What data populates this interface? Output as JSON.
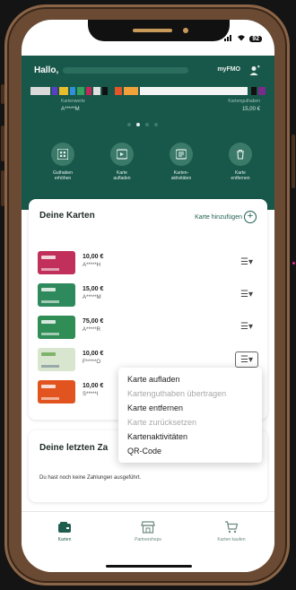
{
  "status": {
    "wifi": "▲",
    "battery": "92"
  },
  "header": {
    "greeting": "Hallo,",
    "brand": "myFMO"
  },
  "balance": {
    "left_label": "Kartenwerte",
    "left_value": "A*****M",
    "right_label": "Kartenguthaben",
    "right_value": "15,00 €"
  },
  "quick_actions": [
    {
      "label": "Guthaben\nerhöhen",
      "icon": "grid-icon"
    },
    {
      "label": "Karte\naufladen",
      "icon": "card-load-icon"
    },
    {
      "label": "Karten-\naktivitäten",
      "icon": "activity-icon"
    },
    {
      "label": "Karte\nentfernen",
      "icon": "trash-icon"
    }
  ],
  "cards_panel": {
    "title": "Deine Karten",
    "add_label": "Karte hinzufügen",
    "cards": [
      {
        "amount": "10,00 €",
        "id": "A*****H",
        "color": "#c0305a"
      },
      {
        "amount": "15,00 €",
        "id": "A*****M",
        "color": "#2e8a5c"
      },
      {
        "amount": "75,00 €",
        "id": "A*****R",
        "color": "#2f8d55"
      },
      {
        "amount": "10,00 €",
        "id": "F*****O",
        "color": "#d8e6cf"
      },
      {
        "amount": "10,00 €",
        "id": "S*****I",
        "color": "#e2541f"
      }
    ]
  },
  "dropdown": {
    "options": [
      {
        "label": "Karte aufladen",
        "enabled": true
      },
      {
        "label": "Kartenguthaben übertragen",
        "enabled": false
      },
      {
        "label": "Karte entfernen",
        "enabled": true
      },
      {
        "label": "Karte zurücksetzen",
        "enabled": false
      },
      {
        "label": "Kartenaktivitäten",
        "enabled": true
      },
      {
        "label": "QR-Code",
        "enabled": true
      }
    ]
  },
  "payments_panel": {
    "title": "Deine letzten Za",
    "empty_text": "Du hast noch keine Zahlungen ausgeführt."
  },
  "bottom_nav": [
    {
      "label": "Karten",
      "icon": "wallet-icon",
      "active": true
    },
    {
      "label": "Partnershops",
      "icon": "shop-icon",
      "active": false
    },
    {
      "label": "Karten kaufen",
      "icon": "cart-icon",
      "active": false
    }
  ],
  "colors": {
    "primary": "#18584a",
    "accent": "#1f5e4f"
  }
}
